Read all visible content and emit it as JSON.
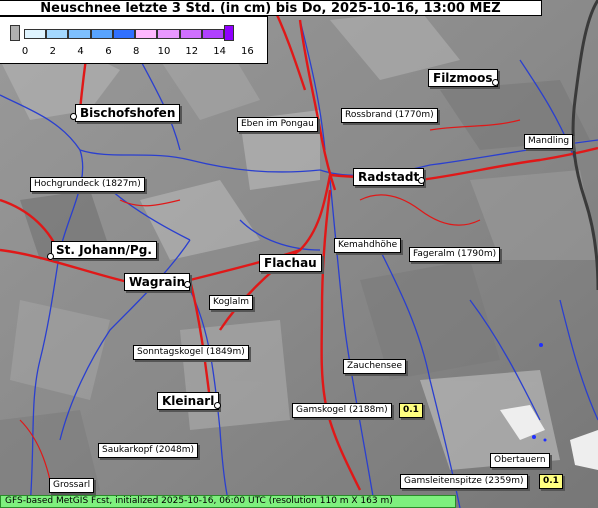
{
  "title": "Neuschnee letzte 3 Std. (in cm) bis Do, 2025-10-16, 13:00 MEZ",
  "legend": {
    "colors": [
      "#b0b0b0",
      "#dff4ff",
      "#a4d8ff",
      "#7ec0ff",
      "#58a4ff",
      "#3070ff",
      "#ffb8ff",
      "#e898ff",
      "#d070ff",
      "#b040ff",
      "#9000ff"
    ],
    "ticks": [
      "0",
      "2",
      "4",
      "6",
      "8",
      "10",
      "12",
      "14",
      "16"
    ]
  },
  "places": [
    {
      "name": "Filzmoos",
      "size": "big"
    },
    {
      "name": "Bischofshofen",
      "size": "big"
    },
    {
      "name": "Rossbrand (1770m)",
      "size": "small"
    },
    {
      "name": "Eben im Pongau",
      "size": "small"
    },
    {
      "name": "Mandling",
      "size": "small"
    },
    {
      "name": "Radstadt",
      "size": "big"
    },
    {
      "name": "Hochgrundeck (1827m)",
      "size": "small"
    },
    {
      "name": "Kemahdhöhe",
      "size": "small"
    },
    {
      "name": "Fageralm (1790m)",
      "size": "small"
    },
    {
      "name": "St. Johann/Pg.",
      "size": "big"
    },
    {
      "name": "Flachau",
      "size": "big"
    },
    {
      "name": "Wagrain",
      "size": "big"
    },
    {
      "name": "Koglalm",
      "size": "small"
    },
    {
      "name": "Sonntagskogel (1849m)",
      "size": "small"
    },
    {
      "name": "Zauchensee",
      "size": "small"
    },
    {
      "name": "Kleinarl",
      "size": "big"
    },
    {
      "name": "Gamskogel (2188m)",
      "size": "small",
      "value": "0.1"
    },
    {
      "name": "Saukarkopf (2048m)",
      "size": "small"
    },
    {
      "name": "Obertauern",
      "size": "small"
    },
    {
      "name": "Grossarl",
      "size": "small"
    },
    {
      "name": "Gamsleitenspitze (2359m)",
      "size": "small",
      "value": "0.1"
    }
  ],
  "footer": "GFS-based MetGIS Fcst, initialized 2025-10-16, 06:00 UTC  (resolution 110 m X 163 m)"
}
